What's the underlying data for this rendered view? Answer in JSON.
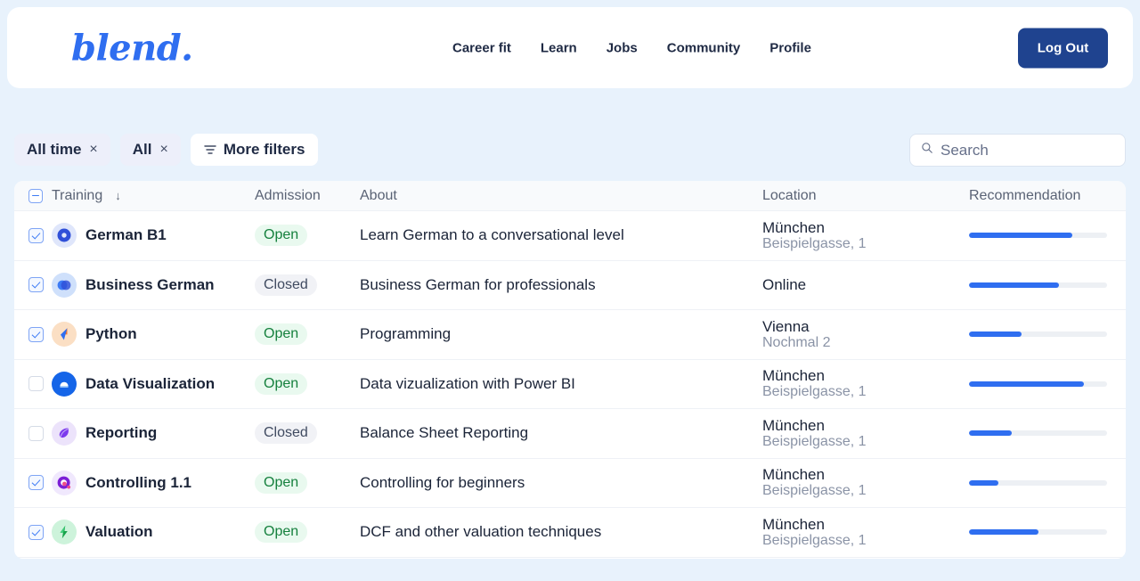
{
  "header": {
    "logo": "blend.",
    "nav": [
      {
        "label": "Career fit"
      },
      {
        "label": "Learn"
      },
      {
        "label": "Jobs"
      },
      {
        "label": "Community"
      },
      {
        "label": "Profile"
      }
    ],
    "logout_label": "Log Out"
  },
  "filters": {
    "chips": [
      {
        "label": "All time",
        "remove": "×"
      },
      {
        "label": "All",
        "remove": "×"
      }
    ],
    "more_label": "More filters"
  },
  "search": {
    "value": "",
    "placeholder": "Search"
  },
  "table": {
    "headers": {
      "training": "Training",
      "sort_arrow": "↓",
      "admission": "Admission",
      "about": "About",
      "location": "Location",
      "recommendation": "Recommendation"
    },
    "rows": [
      {
        "checked": true,
        "icon": "crescent-c-icon",
        "name": "German B1",
        "admission": "Open",
        "admission_state": "open",
        "about": "Learn German to a conversational level",
        "location_city": "München",
        "location_address": "Beispielgasse, 1",
        "recommendation": 75
      },
      {
        "checked": true,
        "icon": "overlapping-circles-icon",
        "name": "Business German",
        "admission": "Closed",
        "admission_state": "closed",
        "about": "Business German for professionals",
        "location_city": "Online",
        "location_address": "",
        "recommendation": 65
      },
      {
        "checked": true,
        "icon": "python-swoosh-icon",
        "name": "Python",
        "admission": "Open",
        "admission_state": "open",
        "about": "Programming",
        "location_city": "Vienna",
        "location_address": "Nochmal 2",
        "recommendation": 38
      },
      {
        "checked": false,
        "icon": "cloud-circle-icon",
        "name": "Data Visualization",
        "admission": "Open",
        "admission_state": "open",
        "about": "Data vizualization with Power BI",
        "location_city": "München",
        "location_address": "Beispielgasse, 1",
        "recommendation": 83
      },
      {
        "checked": false,
        "icon": "purple-leaf-icon",
        "name": "Reporting",
        "admission": "Closed",
        "admission_state": "closed",
        "about": "Balance Sheet Reporting",
        "location_city": "München",
        "location_address": "Beispielgasse, 1",
        "recommendation": 31
      },
      {
        "checked": true,
        "icon": "magenta-orb-icon",
        "name": "Controlling 1.1",
        "admission": "Open",
        "admission_state": "open",
        "about": "Controlling for beginners",
        "location_city": "München",
        "location_address": "Beispielgasse, 1",
        "recommendation": 21
      },
      {
        "checked": true,
        "icon": "green-bolt-icon",
        "name": "Valuation",
        "admission": "Open",
        "admission_state": "open",
        "about": "DCF and other valuation techniques",
        "location_city": "München",
        "location_address": "Beispielgasse, 1",
        "recommendation": 50
      }
    ]
  },
  "colors": {
    "page_background": "#e8f2fc",
    "brand_blue": "#2f6ef0",
    "logout_navy": "#1f438f",
    "open_green": "#15803d",
    "closed_gray": "#3f4a60",
    "bar_fill": "#2f6ef0",
    "bar_track": "#edf0f4"
  }
}
